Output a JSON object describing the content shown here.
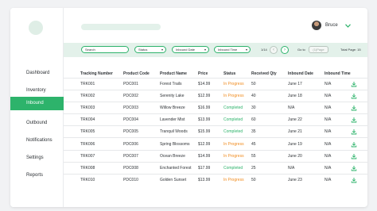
{
  "sidebar": {
    "items": [
      {
        "label": "Dashboard"
      },
      {
        "label": "Inventory"
      },
      {
        "label": "Inbound"
      },
      {
        "label": "Outbound"
      },
      {
        "label": "Notifications"
      },
      {
        "label": "Settings"
      },
      {
        "label": "Reports"
      }
    ],
    "active_index": 2
  },
  "user": {
    "name": "Bruce"
  },
  "filters": {
    "search": {
      "placeholder": "Search"
    },
    "status": {
      "label": "Status"
    },
    "inbound_date": {
      "label": "Inbound Date"
    },
    "inbound_time": {
      "label": "Inbound Time"
    }
  },
  "pagination": {
    "page_indicator": "1/14",
    "prev_icon": "chevron-left",
    "next_icon": "chevron-right",
    "goto_label": "Go to",
    "goto_placeholder": "(1)Page",
    "total_pages": "Total Page: 15"
  },
  "table": {
    "columns": [
      "Tracking Number",
      "Product Code",
      "Product Name",
      "Price",
      "Status",
      "Received Qty",
      "Inbound Date",
      "Inbound Time"
    ],
    "rows": [
      {
        "tracking": "TRK001",
        "code": "PDC001",
        "name": "Forest Trails",
        "price": "$14.99",
        "status": "In Progress",
        "qty": "50",
        "date": "June 17",
        "time": "N/A"
      },
      {
        "tracking": "TRK002",
        "code": "PDC002",
        "name": "Serenity Lake",
        "price": "$12.99",
        "status": "In Progress",
        "qty": "40",
        "date": "June 18",
        "time": "N/A"
      },
      {
        "tracking": "TRK003",
        "code": "PDC003",
        "name": "Willow Breeze",
        "price": "$16.99",
        "status": "Completed",
        "qty": "30",
        "date": "N/A",
        "time": "N/A"
      },
      {
        "tracking": "TRK004",
        "code": "PDC004",
        "name": "Lavender Mist",
        "price": "$13.99",
        "status": "Completed",
        "qty": "60",
        "date": "June 22",
        "time": "N/A"
      },
      {
        "tracking": "TRK005",
        "code": "PDC005",
        "name": "Tranquil Woods",
        "price": "$15.99",
        "status": "Completed",
        "qty": "35",
        "date": "June 21",
        "time": "N/A"
      },
      {
        "tracking": "TRK006",
        "code": "PDC006",
        "name": "Spring Blossoms",
        "price": "$12.99",
        "status": "In Progress",
        "qty": "45",
        "date": "June 19",
        "time": "N/A"
      },
      {
        "tracking": "TRK007",
        "code": "PDC007",
        "name": "Ocean Breeze",
        "price": "$14.99",
        "status": "In Progress",
        "qty": "55",
        "date": "June 20",
        "time": "N/A"
      },
      {
        "tracking": "TRK008",
        "code": "PDC008",
        "name": "Enchanted Forest",
        "price": "$17.99",
        "status": "Completed",
        "qty": "25",
        "date": "N/A",
        "time": "N/A"
      },
      {
        "tracking": "TRK010",
        "code": "PDC010",
        "name": "Golden Sunset",
        "price": "$13.99",
        "status": "In Progress",
        "qty": "50",
        "date": "June 23",
        "time": "N/A"
      }
    ]
  },
  "colors": {
    "accent": "#2db36b",
    "in_progress": "#f08a1c",
    "completed": "#2db36b",
    "toolbar_bg": "#e3f1ea"
  },
  "icons": {
    "logo": "logo-circle",
    "user_menu": "chevron-down-icon",
    "row_action": "download-icon"
  }
}
